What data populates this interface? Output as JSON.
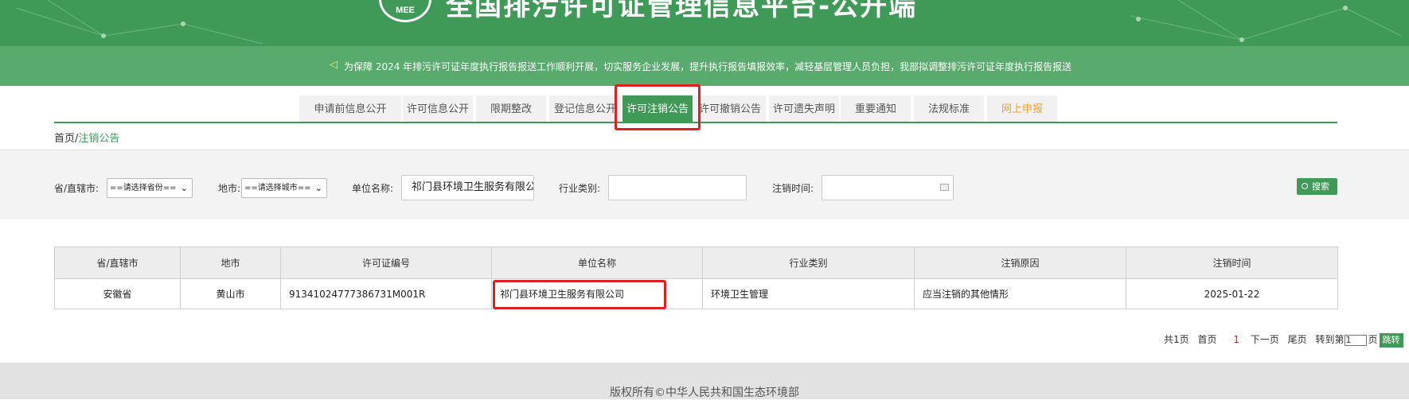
{
  "header": {
    "title": "全国排污许可证管理信息平台-公开端",
    "logo_text": "MEE"
  },
  "notice": {
    "text": "为保障 2024 年排污许可证年度执行报告报送工作顺利开展，切实服务企业发展，提升执行报告填报效率，减轻基层管理人员负担，我部拟调整排污许可证年度执行报告报送"
  },
  "nav": {
    "items": [
      {
        "label": "申请前信息公开"
      },
      {
        "label": "许可信息公开"
      },
      {
        "label": "限期整改"
      },
      {
        "label": "登记信息公开"
      },
      {
        "label": "许可注销公告"
      },
      {
        "label": "许可撤销公告"
      },
      {
        "label": "许可遗失声明"
      },
      {
        "label": "重要通知"
      },
      {
        "label": "法规标准"
      },
      {
        "label": "网上申报"
      }
    ],
    "active_index": 4
  },
  "breadcrumb": {
    "home": "首页",
    "separator": "/",
    "current": "注销公告"
  },
  "filters": {
    "province_label": "省/直辖市:",
    "province_value": "==请选择省份==",
    "city_label": "地市:",
    "city_value": "==请选择城市==",
    "unit_label": "单位名称:",
    "unit_value": "祁门县环境卫生服务有限公司",
    "industry_label": "行业类别:",
    "industry_value": "",
    "date_label": "注销时间:",
    "date_value": "",
    "search_label": "搜索"
  },
  "table": {
    "columns": [
      "省/直辖市",
      "地市",
      "许可证编号",
      "单位名称",
      "行业类别",
      "注销原因",
      "注销时间"
    ],
    "rows": [
      [
        "安徽省",
        "黄山市",
        "91341024777386731M001R",
        "祁门县环境卫生服务有限公司",
        "环境卫生管理",
        "应当注销的其他情形",
        "2025-01-22"
      ]
    ]
  },
  "pager": {
    "total": "共1页",
    "first": "首页",
    "current": "1",
    "next": "下一页",
    "last": "尾页",
    "goto_prefix": "转到第",
    "goto_value": "1",
    "goto_suffix": "页",
    "go_label": "跳转"
  },
  "footer": {
    "copyright": "版权所有©中华人民共和国生态环境部"
  },
  "colors": {
    "brand_green": "#3f9a57",
    "notice_green": "#58ab6c",
    "highlight_red": "#e02020",
    "special_orange": "#f0a030"
  }
}
